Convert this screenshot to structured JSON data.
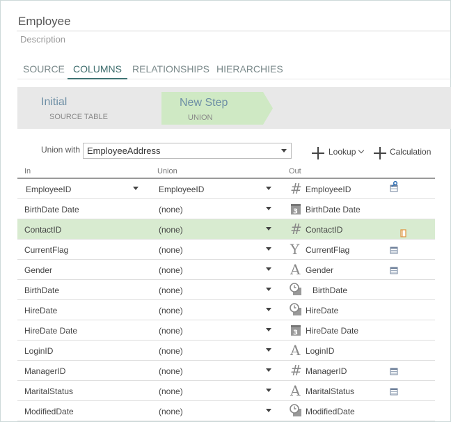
{
  "header": {
    "title": "Employee",
    "description": "Description"
  },
  "tabs": [
    {
      "label": "SOURCE",
      "active": false
    },
    {
      "label": "COLUMNS",
      "active": true
    },
    {
      "label": "RELATIONSHIPS",
      "active": false
    },
    {
      "label": "HIERARCHIES",
      "active": false
    }
  ],
  "steps": [
    {
      "title": "Initial",
      "subtitle": "SOURCE TABLE"
    },
    {
      "title": "New Step",
      "subtitle": "UNION"
    }
  ],
  "union": {
    "label": "Union with",
    "selected": "EmployeeAddress"
  },
  "actions": {
    "lookup": "Lookup",
    "calculation": "Calculation"
  },
  "columns_header": {
    "in": "In",
    "union": "Union",
    "out": "Out"
  },
  "colors": {
    "accent": "#3f7373",
    "selected_row": "#d8ebd0",
    "step_active": "#cfe9c4"
  },
  "rows": [
    {
      "in": "EmployeeID",
      "union": "EmployeeID",
      "out": "EmployeeID",
      "type_icon": "hash-icon",
      "in_dropdown": true,
      "right_icon": "key-table-icon"
    },
    {
      "in": "BirthDate Date",
      "union": "(none)",
      "out": "BirthDate Date",
      "type_icon": "calendar-icon",
      "right_icon": ""
    },
    {
      "in": "ContactID",
      "union": "(none)",
      "out": "ContactID",
      "type_icon": "hash-icon",
      "right_icon": "orange-doc-icon",
      "selected": true
    },
    {
      "in": "CurrentFlag",
      "union": "(none)",
      "out": "CurrentFlag",
      "type_icon": "boolean-icon",
      "right_icon": "table-icon"
    },
    {
      "in": "Gender",
      "union": "(none)",
      "out": "Gender",
      "type_icon": "text-icon",
      "right_icon": "table-icon"
    },
    {
      "in": "BirthDate",
      "union": "(none)",
      "out": "BirthDate",
      "type_icon": "datetime-icon",
      "right_icon": ""
    },
    {
      "in": "HireDate",
      "union": "(none)",
      "out": "HireDate",
      "type_icon": "datetime-icon",
      "right_icon": ""
    },
    {
      "in": "HireDate Date",
      "union": "(none)",
      "out": "HireDate Date",
      "type_icon": "calendar-icon",
      "right_icon": ""
    },
    {
      "in": "LoginID",
      "union": "(none)",
      "out": "LoginID",
      "type_icon": "text-icon",
      "right_icon": ""
    },
    {
      "in": "ManagerID",
      "union": "(none)",
      "out": "ManagerID",
      "type_icon": "hash-icon",
      "right_icon": "table-icon"
    },
    {
      "in": "MaritalStatus",
      "union": "(none)",
      "out": "MaritalStatus",
      "type_icon": "text-icon",
      "right_icon": "table-icon"
    },
    {
      "in": "ModifiedDate",
      "union": "(none)",
      "out": "ModifiedDate",
      "type_icon": "datetime-icon",
      "right_icon": ""
    }
  ]
}
